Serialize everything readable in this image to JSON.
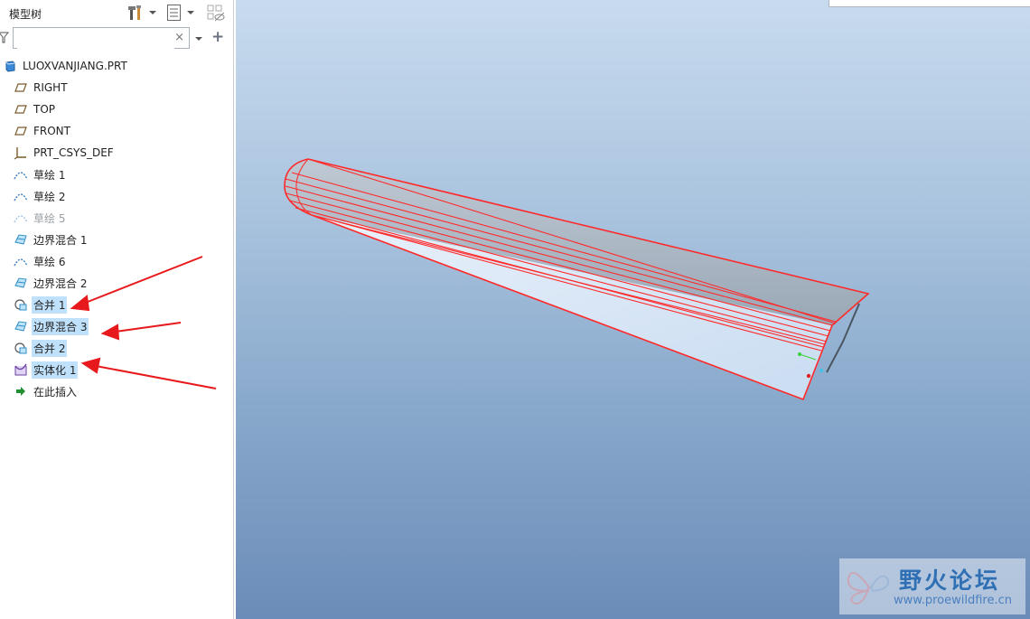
{
  "sidebar": {
    "title": "模型树",
    "search": {
      "value": "",
      "clear_glyph": "×",
      "add_glyph": "+"
    },
    "tree": [
      {
        "label": "LUOXVANJIANG.PRT",
        "icon": "part-icon",
        "state": "normal"
      },
      {
        "label": "RIGHT",
        "icon": "datum-plane-icon",
        "state": "normal"
      },
      {
        "label": "TOP",
        "icon": "datum-plane-icon",
        "state": "normal"
      },
      {
        "label": "FRONT",
        "icon": "datum-plane-icon",
        "state": "normal"
      },
      {
        "label": "PRT_CSYS_DEF",
        "icon": "coordinate-system-icon",
        "state": "normal"
      },
      {
        "label": "草绘 1",
        "icon": "sketch-icon",
        "state": "normal"
      },
      {
        "label": "草绘 2",
        "icon": "sketch-icon",
        "state": "normal"
      },
      {
        "label": "草绘 5",
        "icon": "sketch-icon",
        "state": "suppressed"
      },
      {
        "label": "边界混合 1",
        "icon": "boundary-blend-icon",
        "state": "normal"
      },
      {
        "label": "草绘 6",
        "icon": "sketch-icon",
        "state": "normal"
      },
      {
        "label": "边界混合 2",
        "icon": "boundary-blend-icon",
        "state": "normal"
      },
      {
        "label": "合并 1",
        "icon": "merge-icon",
        "state": "selected"
      },
      {
        "label": "边界混合 3",
        "icon": "boundary-blend-icon",
        "state": "selected"
      },
      {
        "label": "合并 2",
        "icon": "merge-icon",
        "state": "selected"
      },
      {
        "label": "实体化 1",
        "icon": "solidify-icon",
        "state": "selected"
      },
      {
        "label": "在此插入",
        "icon": "insert-here-arrow-icon",
        "state": "normal"
      }
    ]
  },
  "watermark": {
    "title": "野火论坛",
    "url": "www.proewildfire.cn"
  },
  "colors": {
    "selection": "#bfe1fb",
    "edge_highlight": "#ff2a2a",
    "annotation_arrow": "#e8191c",
    "viewport_top": "#c8dbee",
    "viewport_bottom": "#6b8cb8"
  }
}
